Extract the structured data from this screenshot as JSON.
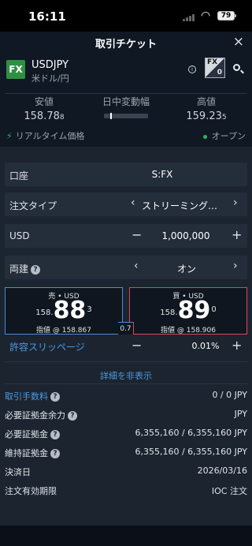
{
  "status": {
    "time": "16:11",
    "battery": "79"
  },
  "header": {
    "title": "取引チケット"
  },
  "instrument": {
    "badge": "FX",
    "pair": "USDJPY",
    "subtitle": "米ドル/円"
  },
  "quotes": {
    "bid_label": "安値",
    "bid_main": "158.78",
    "bid_small": "8",
    "range_label": "日中変動幅",
    "range_position": 0.15,
    "high_label": "高値",
    "high_main": "159.23",
    "high_small": "5"
  },
  "market": {
    "realtime": "リアルタイム価格",
    "status": "オープン"
  },
  "form": {
    "account_label": "口座",
    "account_value": "S:FX",
    "order_type_label": "注文タイプ",
    "order_type_value": "ストリーミング…",
    "currency_label": "USD",
    "quantity": "1,000,000",
    "hedge_label": "両建",
    "hedge_value": "オン"
  },
  "prices": {
    "sell_header": "売 • USD",
    "sell_prefix": "158.",
    "sell_big": "88",
    "sell_sup": "3",
    "sell_limit": "指値 @ 158.867",
    "buy_header": "買 • USD",
    "buy_prefix": "158.",
    "buy_big": "89",
    "buy_sup": "0",
    "buy_limit": "指値 @ 158.906",
    "spread": "0.7"
  },
  "slippage": {
    "label": "許容スリッページ",
    "value": "0.01%"
  },
  "details_toggle": "詳細を非表示",
  "details": [
    {
      "label": "取引手数料",
      "value": "0 / 0 JPY"
    },
    {
      "label": "必要証拠金余力",
      "value": "JPY"
    },
    {
      "label": "必要証拠金",
      "value": "6,355,160 / 6,355,160 JPY"
    },
    {
      "label": "維持証拠金",
      "value": "6,355,160 / 6,355,160 JPY"
    },
    {
      "label": "決済日",
      "value": "2026/03/16"
    },
    {
      "label": "注文有効期限",
      "value": "IOC 注文"
    }
  ],
  "colors": {
    "accent_blue": "#4a9ae0",
    "sell": "#4a8cd8",
    "buy": "#d9485a",
    "live": "#32b457",
    "fx_badge": "#2f8f43"
  }
}
